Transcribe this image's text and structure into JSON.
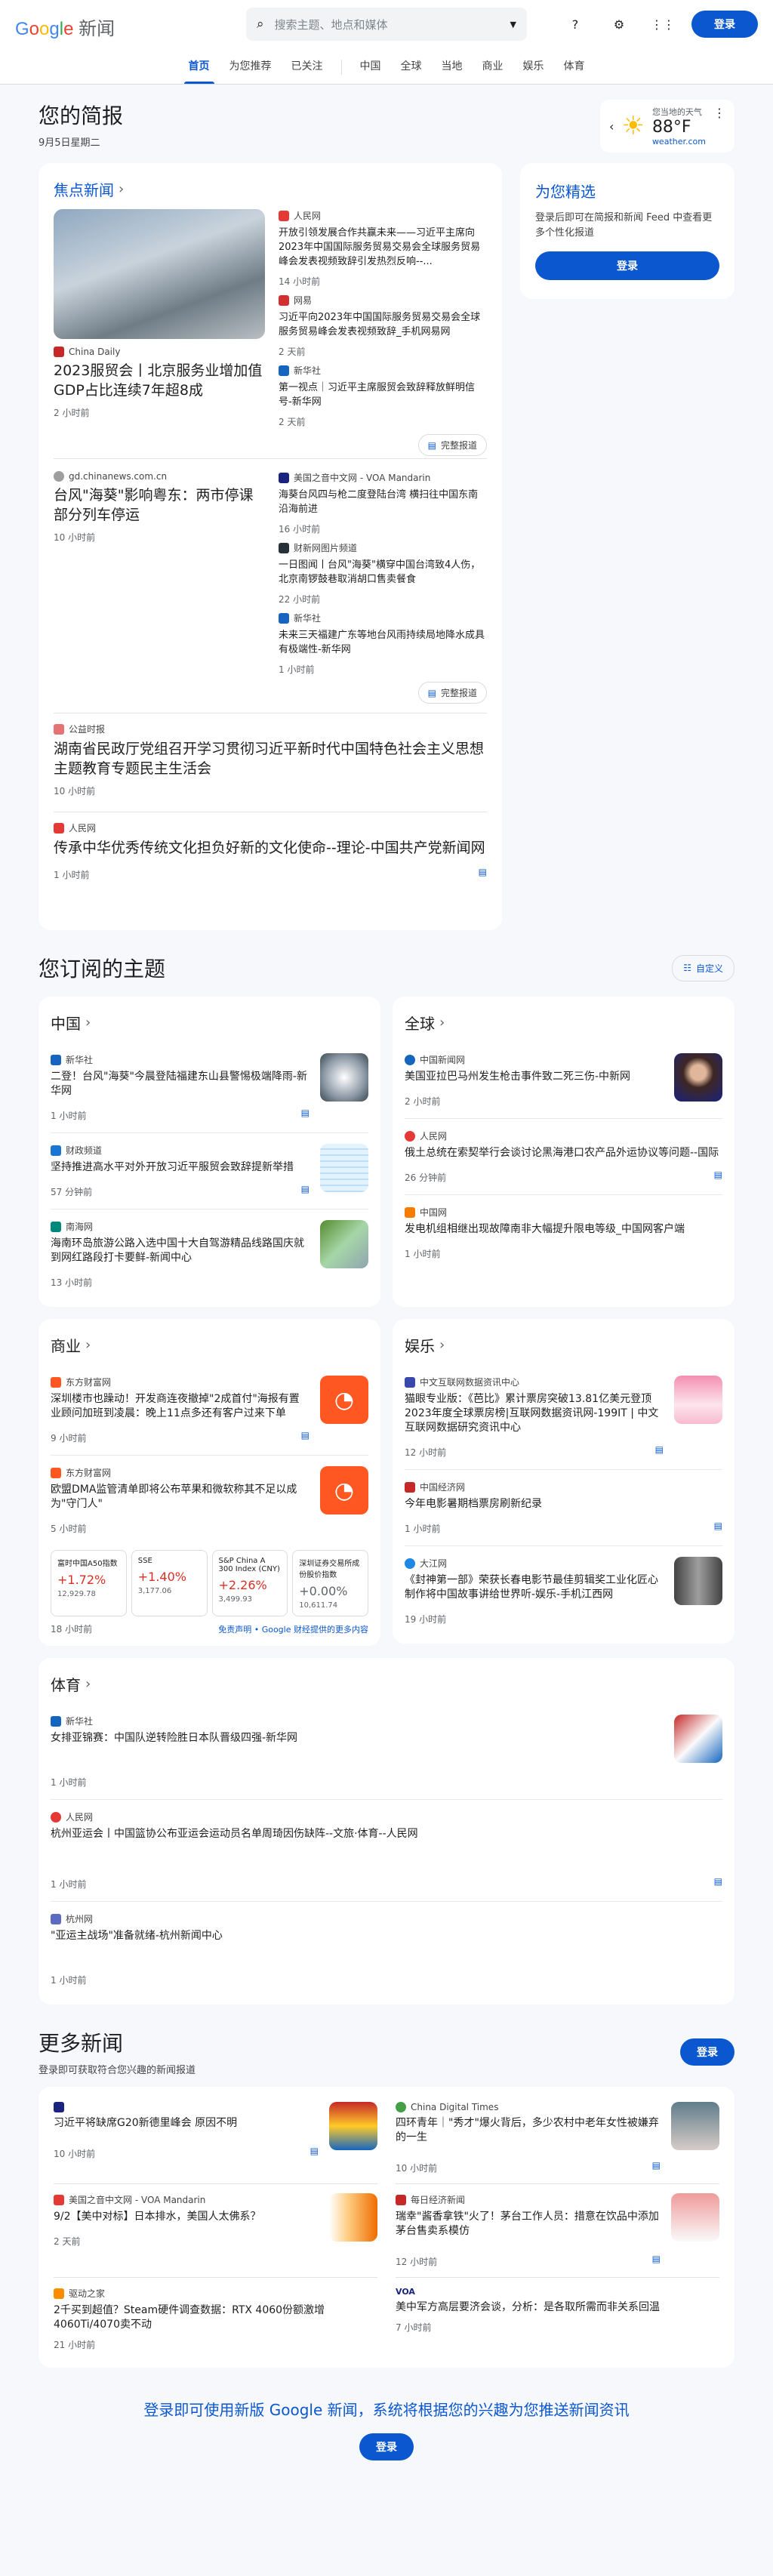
{
  "header": {
    "logo": "Google 新闻",
    "search_placeholder": "搜索主题、地点和媒体",
    "signin": "登录"
  },
  "nav": [
    "首页",
    "为您推荐",
    "已关注",
    "中国",
    "全球",
    "当地",
    "商业",
    "娱乐",
    "体育"
  ],
  "brief": {
    "title": "您的简报",
    "date": "9月5日星期二"
  },
  "weather": {
    "label": "您当地的天气",
    "temp": "88°F",
    "source": "weather.com"
  },
  "top": {
    "title": "焦点新闻",
    "full": "完整报道",
    "s1": {
      "main": {
        "src": "China Daily",
        "t": "2023服贸会丨北京服务业增加值GDP占比连续7年超8成",
        "tm": "2 小时前"
      },
      "side": [
        {
          "src": "人民网",
          "t": "开放引领发展合作共赢未来——习近平主席向2023年中国国际服务贸易交易会全球服务贸易峰会发表视频致辞引发热烈反响--...",
          "tm": "14 小时前"
        },
        {
          "src": "网易",
          "t": "习近平向2023年中国国际服务贸易交易会全球服务贸易峰会发表视频致辞_手机网易网",
          "tm": "2 天前"
        },
        {
          "src": "新华社",
          "t": "第一视点｜习近平主席服贸会致辞释放鲜明信号-新华网",
          "tm": "2 天前"
        }
      ]
    },
    "s2": {
      "main": {
        "src": "gd.chinanews.com.cn",
        "t": "台风\"海葵\"影响粤东：两市停课部分列车停运",
        "tm": "10 小时前"
      },
      "side": [
        {
          "src": "美国之音中文网 - VOA Mandarin",
          "t": "海葵台风四与枪二度登陆台湾 横扫往中国东南沿海前进",
          "tm": "16 小时前"
        },
        {
          "src": "财新网图片频道",
          "t": "一日图闻丨台风\"海葵\"横穿中国台湾致4人伤，北京南锣鼓巷取消胡口售卖餐食",
          "tm": "22 小时前"
        },
        {
          "src": "新华社",
          "t": "未来三天福建广东等地台风雨持续局地降水成具有极端性-新华网",
          "tm": "1 小时前"
        }
      ]
    },
    "s3": {
      "src": "公益时报",
      "t": "湖南省民政厅党组召开学习贯彻习近平新时代中国特色社会主义思想主题教育专题民主生活会",
      "tm": "10 小时前"
    },
    "s4": {
      "src": "人民网",
      "t": "传承中华优秀传统文化担负好新的文化使命--理论-中国共产党新闻网",
      "tm": "1 小时前"
    }
  },
  "pick": {
    "title": "为您精选",
    "text": "登录后即可在简报和新闻 Feed 中查看更多个性化报道",
    "btn": "登录"
  },
  "topics": {
    "title": "您订阅的主题",
    "customize": "自定义",
    "china": {
      "title": "中国",
      "items": [
        {
          "src": "新华社",
          "t": "二登！台风\"海葵\"今晨登陆福建东山县警惕极端降雨-新华网",
          "tm": "1 小时前"
        },
        {
          "src": "财政频道",
          "t": "坚持推进高水平对外开放习近平服贸会致辞提新举措",
          "tm": "57 分钟前"
        },
        {
          "src": "南海网",
          "t": "海南环岛旅游公路入选中国十大自驾游精品线路国庆就到网红路段打卡要鲜-新闻中心",
          "tm": "13 小时前"
        }
      ]
    },
    "world": {
      "title": "全球",
      "items": [
        {
          "src": "中国新闻网",
          "t": "美国亚拉巴马州发生枪击事件致二死三伤-中新网",
          "tm": "2 小时前"
        },
        {
          "src": "人民网",
          "t": "俄土总统在索契举行会谈讨论黑海港口农产品外运协议等问题--国际",
          "tm": "26 分钟前"
        },
        {
          "src": "中国网",
          "t": "发电机组相继出现故障南非大幅提升限电等级_中国网客户端",
          "tm": "1 小时前"
        }
      ]
    },
    "biz": {
      "title": "商业",
      "items": [
        {
          "src": "东方财富网",
          "t": "深圳楼市也躁动！开发商连夜撤掉\"2成首付\"海报有置业顾问加班到凌晨：晚上11点多还有客户过来下单",
          "tm": "9 小时前"
        },
        {
          "src": "东方财富网",
          "t": "欧盟DMA监管清单即将公布苹果和微软称其不足以成为\"守门人\"",
          "tm": "5 小时前"
        }
      ],
      "stocks": [
        {
          "n": "富时中国A50指数",
          "c": "+1.72%",
          "p": "12,929.78"
        },
        {
          "n": "SSE",
          "c": "+1.40%",
          "p": "3,177.06"
        },
        {
          "n": "S&P China A 300 Index (CNY)",
          "c": "+2.26%",
          "p": "3,499.93"
        },
        {
          "n": "深圳证券交易所成份股价指数",
          "c": "+0.00%",
          "p": "10,611.74"
        }
      ],
      "stock_time": "18 小时前",
      "disclaimer": "免责声明 • Google 财经提供的更多内容"
    },
    "ent": {
      "title": "娱乐",
      "items": [
        {
          "src": "中文互联网数据资讯中心",
          "t": "猫眼专业版：《芭比》累计票房突破13.81亿美元登顶2023年度全球票房榜|互联网数据资讯网-199IT | 中文互联网数据研究资讯中心",
          "tm": "12 小时前"
        },
        {
          "src": "中国经济网",
          "t": "今年电影暑期档票房刷新纪录",
          "tm": "1 小时前"
        },
        {
          "src": "大江网",
          "t": "《封神第一部》荣获长春电影节最佳剪辑奖工业化匠心制作将中国故事讲给世界听-娱乐-手机江西网",
          "tm": "19 小时前"
        }
      ]
    },
    "sport": {
      "title": "体育",
      "items": [
        {
          "src": "新华社",
          "t": "女排亚锦赛：中国队逆转险胜日本队晋级四强-新华网",
          "tm": "1 小时前"
        },
        {
          "src": "人民网",
          "t": "杭州亚运会丨中国篮协公布亚运会运动员名单周琦因伤缺阵--文旅·体育--人民网",
          "tm": "1 小时前"
        },
        {
          "src": "杭州网",
          "t": "\"亚运主战场\"准备就绪-杭州新闻中心",
          "tm": "1 小时前"
        }
      ]
    }
  },
  "more": {
    "title": "更多新闻",
    "sub": "登录即可获取符合您兴趣的新闻报道",
    "btn": "登录",
    "items": [
      {
        "src": "",
        "t": "习近平将缺席G20新德里峰会 原因不明",
        "tm": "10 小时前"
      },
      {
        "src": "China Digital Times",
        "t": "四环青年｜\"秀才\"爆火背后，多少农村中老年女性被嫌弃的一生",
        "tm": "10 小时前"
      },
      {
        "src": "美国之音中文网 - VOA Mandarin",
        "t": "9/2【美中对标】日本排水，美国人太佛系？",
        "tm": "2 天前"
      },
      {
        "src": "每日经济新闻",
        "t": "瑞幸\"酱香拿铁\"火了！茅台工作人员：措意在饮品中添加茅台售卖系模仿",
        "tm": "12 小时前"
      },
      {
        "src": "驱动之家",
        "t": "2千买到超值？Steam硬件调查数据：RTX 4060份额激增 4060Ti/4070卖不动",
        "tm": "21 小时前"
      },
      {
        "src": "VOA",
        "t": "美中军方高层要济会谈，分析：是各取所需而非关系回温",
        "tm": "7 小时前"
      }
    ]
  },
  "promo": {
    "text": "登录即可使用新版 Google 新闻，系统将根据您的兴趣为您推送新闻资讯",
    "btn": "登录"
  }
}
